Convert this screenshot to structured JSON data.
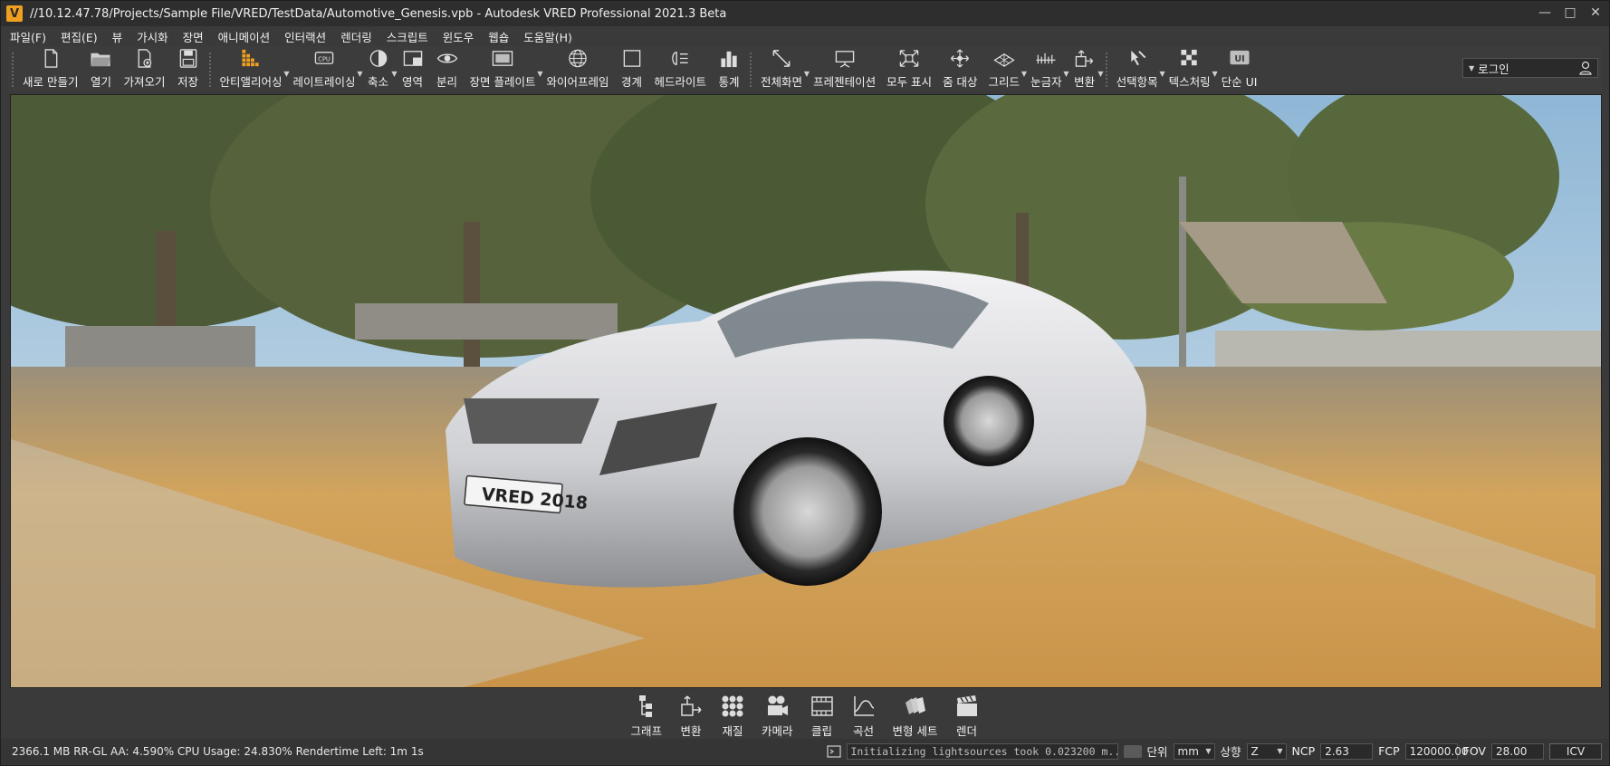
{
  "window": {
    "app_icon_letter": "V",
    "title": "//10.12.47.78/Projects/Sample File/VRED/TestData/Automotive_Genesis.vpb - Autodesk VRED Professional 2021.3 Beta"
  },
  "menu": [
    {
      "label": "파일(F)"
    },
    {
      "label": "편집(E)"
    },
    {
      "label": "뷰"
    },
    {
      "label": "가시화"
    },
    {
      "label": "장면"
    },
    {
      "label": "애니메이션"
    },
    {
      "label": "인터랙션"
    },
    {
      "label": "렌더링"
    },
    {
      "label": "스크립트"
    },
    {
      "label": "윈도우"
    },
    {
      "label": "웹숍"
    },
    {
      "label": "도움말(H)"
    }
  ],
  "toolbar": {
    "new": "새로 만들기",
    "open": "열기",
    "import": "가져오기",
    "save": "저장",
    "antialiasing": "안티앨리어싱",
    "raytracing": "레이트레이싱",
    "cpu_badge": "CPU",
    "shrink": "축소",
    "region": "영역",
    "separate": "분리",
    "scene_plate": "장면 플레이트",
    "wireframe": "와이어프레임",
    "bounds": "경계",
    "headlight": "헤드라이트",
    "statistics": "통계",
    "fullscreen": "전체화면",
    "presentation": "프레젠테이션",
    "show_all": "모두 표시",
    "zoom_target": "줌 대상",
    "grid": "그리드",
    "ruler": "눈금자",
    "transform": "변환",
    "select_item": "선택항목",
    "texturing": "텍스처링",
    "simple_ui": "단순 UI",
    "ui_badge": "UI"
  },
  "login": {
    "label": "로그인"
  },
  "viewport": {
    "plate_text": "VRED 2018"
  },
  "dock": [
    {
      "label": "그래프"
    },
    {
      "label": "변환"
    },
    {
      "label": "재질"
    },
    {
      "label": "카메라"
    },
    {
      "label": "클립"
    },
    {
      "label": "곡선"
    },
    {
      "label": "변형 세트"
    },
    {
      "label": "렌더"
    }
  ],
  "status": {
    "info": "2366.1 MB  RR-GL AA: 4.590% CPU Usage: 24.830% Rendertime Left: 1m 1s",
    "log": "Initializing lightsources took 0.023200 m...",
    "unit_label": "단위",
    "unit_value": "mm",
    "up_label": "상향",
    "up_value": "Z",
    "ncp_label": "NCP",
    "ncp_value": "2.63",
    "fcp_label": "FCP",
    "fcp_value": "120000.00",
    "fov_label": "FOV",
    "fov_value": "28.00",
    "icv_button": "ICV"
  },
  "colors": {
    "accent": "#f0a020",
    "chrome": "#3a3a3a"
  }
}
